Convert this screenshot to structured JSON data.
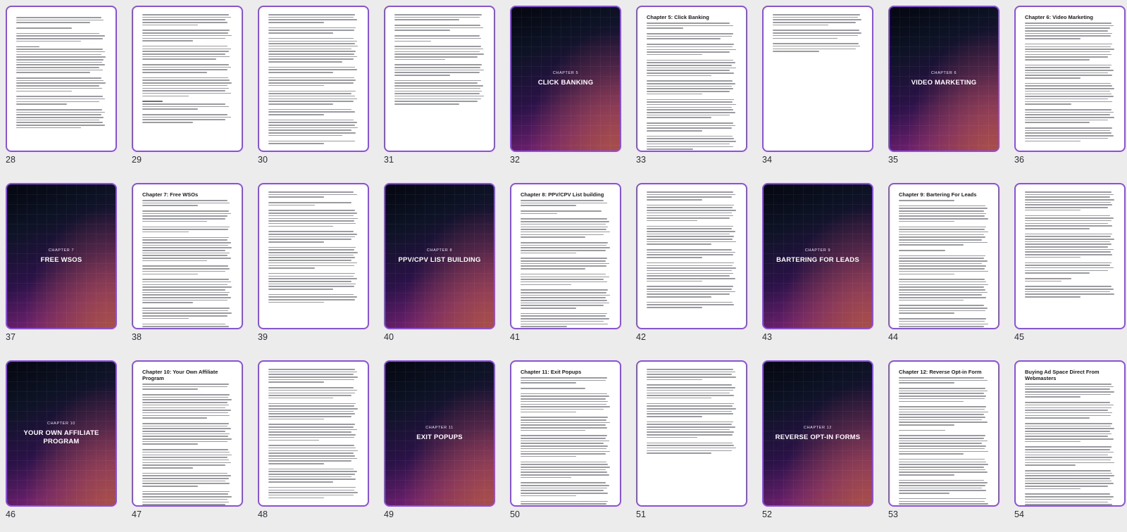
{
  "colors": {
    "selection_border": "#8b4ee6",
    "background": "#ececed",
    "page": "#ffffff"
  },
  "pages": [
    {
      "number": "28",
      "kind": "text",
      "heading": "",
      "layout": "p28"
    },
    {
      "number": "29",
      "kind": "text",
      "heading": "",
      "layout": "p29"
    },
    {
      "number": "30",
      "kind": "text",
      "heading": "",
      "layout": "p30"
    },
    {
      "number": "31",
      "kind": "text",
      "heading": "",
      "layout": "p31"
    },
    {
      "number": "32",
      "kind": "cover",
      "kicker": "CHAPTER 5",
      "title": "CLICK BANKING"
    },
    {
      "number": "33",
      "kind": "text",
      "heading": "Chapter 5: Click Banking",
      "layout": "p33"
    },
    {
      "number": "34",
      "kind": "text",
      "heading": "",
      "layout": "p34"
    },
    {
      "number": "35",
      "kind": "cover",
      "kicker": "CHAPTER 6",
      "title": "VIDEO MARKETING"
    },
    {
      "number": "36",
      "kind": "text",
      "heading": "Chapter 6: Video Marketing",
      "layout": "p36"
    },
    {
      "number": "37",
      "kind": "cover",
      "kicker": "CHAPTER 7",
      "title": "FREE WSOS"
    },
    {
      "number": "38",
      "kind": "text",
      "heading": "Chapter 7: Free WSOs",
      "layout": "p38"
    },
    {
      "number": "39",
      "kind": "text",
      "heading": "",
      "layout": "p39"
    },
    {
      "number": "40",
      "kind": "cover",
      "kicker": "CHAPTER 8",
      "title": "PPV/CPV LIST BUILDING"
    },
    {
      "number": "41",
      "kind": "text",
      "heading": "Chapter 8: PPV/CPV List building",
      "layout": "p41"
    },
    {
      "number": "42",
      "kind": "text",
      "heading": "",
      "layout": "p42"
    },
    {
      "number": "43",
      "kind": "cover",
      "kicker": "CHAPTER 9",
      "title": "BARTERING FOR LEADS"
    },
    {
      "number": "44",
      "kind": "text",
      "heading": "Chapter 9: Bartering For Leads",
      "layout": "p44"
    },
    {
      "number": "45",
      "kind": "text",
      "heading": "",
      "layout": "p45"
    },
    {
      "number": "46",
      "kind": "cover",
      "kicker": "CHAPTER 10",
      "title": "YOUR OWN AFFILIATE PROGRAM"
    },
    {
      "number": "47",
      "kind": "text",
      "heading": "Chapter 10: Your Own Affiliate Program",
      "layout": "p47"
    },
    {
      "number": "48",
      "kind": "text",
      "heading": "",
      "layout": "p48"
    },
    {
      "number": "49",
      "kind": "cover",
      "kicker": "CHAPTER 11",
      "title": "EXIT POPUPS"
    },
    {
      "number": "50",
      "kind": "text",
      "heading": "Chapter 11: Exit Popups",
      "layout": "p50"
    },
    {
      "number": "51",
      "kind": "text",
      "heading": "",
      "layout": "p51"
    },
    {
      "number": "52",
      "kind": "cover",
      "kicker": "CHAPTER 12",
      "title": "REVERSE OPT-IN FORMS"
    },
    {
      "number": "53",
      "kind": "text",
      "heading": "Chapter 12: Reverse Opt-in Form",
      "layout": "p53"
    },
    {
      "number": "54",
      "kind": "text",
      "heading": "Buying Ad Space Direct From Webmasters",
      "layout": "p54"
    }
  ]
}
